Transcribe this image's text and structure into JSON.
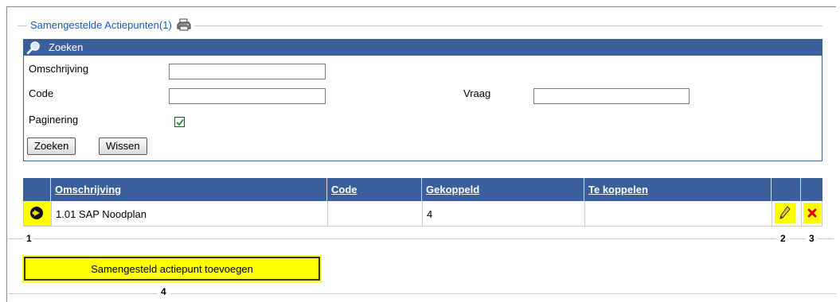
{
  "legend": {
    "title": "Samengestelde Actiepunten(1)",
    "print_icon": "printer-icon"
  },
  "search": {
    "header": "Zoeken",
    "header_icon": "magnifier-icon",
    "fields": {
      "omschrijving_label": "Omschrijving",
      "omschrijving_value": "",
      "code_label": "Code",
      "code_value": "",
      "vraag_label": "Vraag",
      "vraag_value": "",
      "paginering_label": "Paginering",
      "paginering_checked": true
    },
    "buttons": {
      "search": "Zoeken",
      "clear": "Wissen"
    }
  },
  "table": {
    "columns": [
      "Omschrijving",
      "Code",
      "Gekoppeld",
      "Te koppelen"
    ],
    "rows": [
      {
        "omschrijving": "1.01 SAP Noodplan",
        "code": "",
        "gekoppeld": "4",
        "te_koppelen": "",
        "view_icon": "arrow-circle-icon",
        "edit_icon": "pencil-icon",
        "delete_icon": "red-x-icon"
      }
    ]
  },
  "callouts": [
    "1",
    "2",
    "3",
    "4"
  ],
  "add_button": "Samengesteld actiepunt toevoegen",
  "colors": {
    "header_blue": "#3b5f9a",
    "legend_blue": "#1b55c8",
    "highlight": "#ffff00"
  }
}
